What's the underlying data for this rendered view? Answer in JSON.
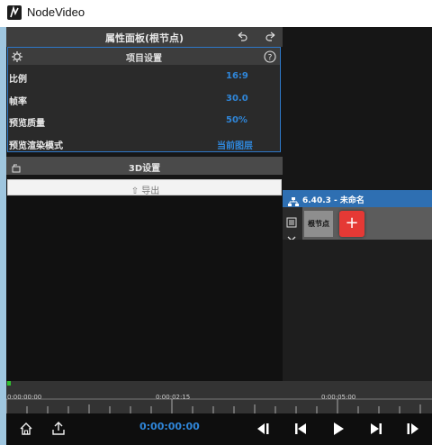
{
  "window": {
    "title": "NodeVideo"
  },
  "properties": {
    "title": "属性面板(根节点)",
    "project_settings": {
      "title": "项目设置",
      "rows": [
        {
          "label": "比例",
          "value": "16:9"
        },
        {
          "label": "帧率",
          "value": "30.0"
        },
        {
          "label": "预览质量",
          "value": "50%"
        },
        {
          "label": "预览渲染模式",
          "value": "当前图层"
        }
      ]
    },
    "settings3d": {
      "label": "3D设置"
    },
    "export": {
      "label": "导出"
    }
  },
  "node_panel": {
    "title": "6.40.3 - 未命名",
    "root_node_label": "根节点",
    "add_label": "+"
  },
  "timeline": {
    "ticks": [
      "0:00:00:00",
      "0:00:02:15",
      "0:00:05:00"
    ],
    "playhead_color": "#30c030"
  },
  "controls": {
    "timecode": "0:00:00:00",
    "icons": [
      "home-icon",
      "share-icon",
      "skip-start-icon",
      "step-back-icon",
      "play-icon",
      "step-forward-icon",
      "skip-end-icon"
    ]
  },
  "colors": {
    "accent": "#2f86d9",
    "add_button": "#e53935",
    "node_titlebar": "#2e6fb2"
  }
}
